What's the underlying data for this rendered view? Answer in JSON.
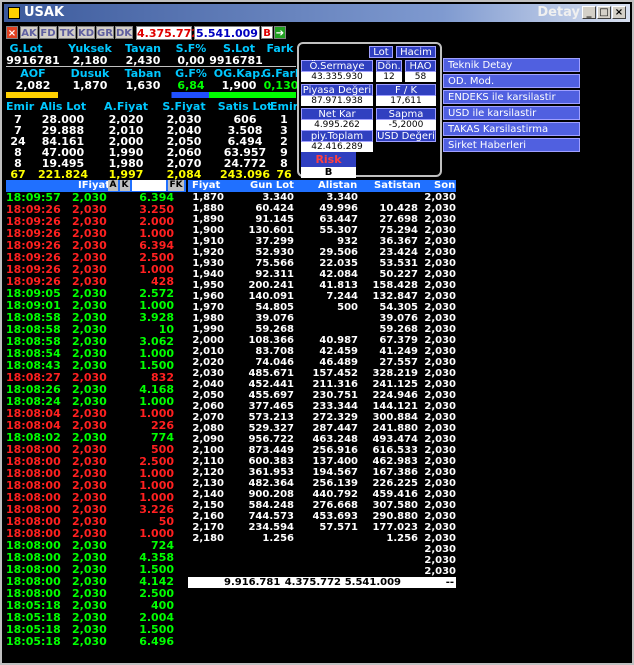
{
  "window": {
    "title": "USAK",
    "detail": "Detay",
    "min": "_",
    "max": "□",
    "close": "×"
  },
  "toolbar": {
    "buttons": [
      "AK",
      "FD",
      "TK",
      "KD",
      "GR",
      "DK"
    ],
    "value1": "4.375.772",
    "value2": "5.541.009",
    "b_label": "B"
  },
  "summary": {
    "row1_headers": [
      "G.Lot",
      "Yuksek",
      "Tavan",
      "S.F%",
      "S.Lot",
      "Fark"
    ],
    "row1_values": [
      "9916781",
      "2,180",
      "2,430",
      "0,00",
      "9916781",
      ""
    ],
    "row2_headers": [
      "AOF",
      "Dusuk",
      "Taban",
      "G.F%",
      "OG.Kap.",
      "G.Fark"
    ],
    "row2_values": [
      "2,082",
      "1,870",
      "1,630",
      "6,84",
      "1,900",
      "0,130"
    ]
  },
  "depth": {
    "headers": [
      "Emir",
      "Alis Lot",
      "A.Fiyat",
      "S.Fiyat",
      "Satis Lot",
      "Emir"
    ],
    "rows": [
      [
        "7",
        "28.000",
        "2,020",
        "2,030",
        "606",
        "1"
      ],
      [
        "7",
        "29.888",
        "2,010",
        "2,040",
        "3.508",
        "3"
      ],
      [
        "24",
        "84.161",
        "2,000",
        "2,050",
        "6.494",
        "2"
      ],
      [
        "8",
        "47.000",
        "1,990",
        "2,060",
        "63.957",
        "9"
      ],
      [
        "8",
        "19.495",
        "1,980",
        "2,070",
        "24.772",
        "8"
      ]
    ],
    "total": [
      "67",
      "221.824",
      "1,997",
      "2,084",
      "243.096",
      "76"
    ]
  },
  "panel": {
    "tabs": [
      "Lot",
      "Hacim"
    ],
    "fields": [
      {
        "label": "Ö.Sermaye",
        "value": "43.335.930"
      },
      {
        "label": "Dön.",
        "value": "12"
      },
      {
        "label": "HAO",
        "value": "58"
      },
      {
        "label": "Piyasa Değeri",
        "value": "87.971.938"
      },
      {
        "label": "F / K",
        "value": "17,611"
      },
      {
        "label": "Net Kar",
        "value": "4.995.262"
      },
      {
        "label": "Sapma",
        "value": "-5,2000"
      },
      {
        "label": "piy.Toplam Lot",
        "value": "42.416.289"
      },
      {
        "label": "USD Değeri",
        "value": ""
      }
    ],
    "risk_label": "Risk Kodu",
    "risk_value": "B"
  },
  "menu": [
    "Teknik Detay",
    "OD. Mod.",
    "ENDEKS ile karsilastir",
    "USD ile karsilastir",
    "TAKAS Karsilastirma",
    "Sirket Haberleri"
  ],
  "trades_header": {
    "price": "IFiyat",
    "a": "A",
    "k": "K",
    "fk": "FK"
  },
  "trades": [
    {
      "t": "18:09:57",
      "p": "2,030",
      "q": "6.394",
      "c": "green"
    },
    {
      "t": "18:09:26",
      "p": "2,030",
      "q": "3.250",
      "c": "red"
    },
    {
      "t": "18:09:26",
      "p": "2,030",
      "q": "2.000",
      "c": "red"
    },
    {
      "t": "18:09:26",
      "p": "2,030",
      "q": "1.000",
      "c": "red"
    },
    {
      "t": "18:09:26",
      "p": "2,030",
      "q": "6.394",
      "c": "red"
    },
    {
      "t": "18:09:26",
      "p": "2,030",
      "q": "2.500",
      "c": "red"
    },
    {
      "t": "18:09:26",
      "p": "2,030",
      "q": "1.000",
      "c": "red"
    },
    {
      "t": "18:09:26",
      "p": "2,030",
      "q": "428",
      "c": "red"
    },
    {
      "t": "18:09:05",
      "p": "2,030",
      "q": "2.572",
      "c": "green"
    },
    {
      "t": "18:09:01",
      "p": "2,030",
      "q": "1.000",
      "c": "green"
    },
    {
      "t": "18:08:58",
      "p": "2,030",
      "q": "3.928",
      "c": "green"
    },
    {
      "t": "18:08:58",
      "p": "2,030",
      "q": "10",
      "c": "green"
    },
    {
      "t": "18:08:58",
      "p": "2,030",
      "q": "3.062",
      "c": "green"
    },
    {
      "t": "18:08:54",
      "p": "2,030",
      "q": "1.000",
      "c": "green"
    },
    {
      "t": "18:08:43",
      "p": "2,030",
      "q": "1.500",
      "c": "green"
    },
    {
      "t": "18:08:27",
      "p": "2,030",
      "q": "832",
      "c": "red"
    },
    {
      "t": "18:08:26",
      "p": "2,030",
      "q": "4.168",
      "c": "green"
    },
    {
      "t": "18:08:24",
      "p": "2,030",
      "q": "1.000",
      "c": "green"
    },
    {
      "t": "18:08:04",
      "p": "2,030",
      "q": "1.000",
      "c": "red"
    },
    {
      "t": "18:08:04",
      "p": "2,030",
      "q": "226",
      "c": "red"
    },
    {
      "t": "18:08:02",
      "p": "2,030",
      "q": "774",
      "c": "green"
    },
    {
      "t": "18:08:00",
      "p": "2,030",
      "q": "500",
      "c": "red"
    },
    {
      "t": "18:08:00",
      "p": "2,030",
      "q": "2.500",
      "c": "red"
    },
    {
      "t": "18:08:00",
      "p": "2,030",
      "q": "1.000",
      "c": "red"
    },
    {
      "t": "18:08:00",
      "p": "2,030",
      "q": "1.000",
      "c": "red"
    },
    {
      "t": "18:08:00",
      "p": "2,030",
      "q": "1.000",
      "c": "red"
    },
    {
      "t": "18:08:00",
      "p": "2,030",
      "q": "3.226",
      "c": "red"
    },
    {
      "t": "18:08:00",
      "p": "2,030",
      "q": "50",
      "c": "red"
    },
    {
      "t": "18:08:00",
      "p": "2,030",
      "q": "1.000",
      "c": "red"
    },
    {
      "t": "18:08:00",
      "p": "2,030",
      "q": "724",
      "c": "green"
    },
    {
      "t": "18:08:00",
      "p": "2,030",
      "q": "4.358",
      "c": "green"
    },
    {
      "t": "18:08:00",
      "p": "2,030",
      "q": "1.500",
      "c": "green"
    },
    {
      "t": "18:08:00",
      "p": "2,030",
      "q": "4.142",
      "c": "green"
    },
    {
      "t": "18:08:00",
      "p": "2,030",
      "q": "2.500",
      "c": "green"
    },
    {
      "t": "18:05:18",
      "p": "2,030",
      "q": "400",
      "c": "green"
    },
    {
      "t": "18:05:18",
      "p": "2,030",
      "q": "2.004",
      "c": "green"
    },
    {
      "t": "18:05:18",
      "p": "2,030",
      "q": "1.500",
      "c": "green"
    },
    {
      "t": "18:05:18",
      "p": "2,030",
      "q": "6.496",
      "c": "green"
    }
  ],
  "price_header": [
    "Fiyat",
    "Gun Lot",
    "Alistan",
    "Satistan",
    "Son"
  ],
  "price_rows": [
    [
      "1,870",
      "3.340",
      "3.340",
      "",
      "2,030"
    ],
    [
      "1,880",
      "60.424",
      "49.996",
      "10.428",
      "2,030"
    ],
    [
      "1,890",
      "91.145",
      "63.447",
      "27.698",
      "2,030"
    ],
    [
      "1,900",
      "130.601",
      "55.307",
      "75.294",
      "2,030"
    ],
    [
      "1,910",
      "37.299",
      "932",
      "36.367",
      "2,030"
    ],
    [
      "1,920",
      "52.930",
      "29.506",
      "23.424",
      "2,030"
    ],
    [
      "1,930",
      "75.566",
      "22.035",
      "53.531",
      "2,030"
    ],
    [
      "1,940",
      "92.311",
      "42.084",
      "50.227",
      "2,030"
    ],
    [
      "1,950",
      "200.241",
      "41.813",
      "158.428",
      "2,030"
    ],
    [
      "1,960",
      "140.091",
      "7.244",
      "132.847",
      "2,030"
    ],
    [
      "1,970",
      "54.805",
      "500",
      "54.305",
      "2,030"
    ],
    [
      "1,980",
      "39.076",
      "",
      "39.076",
      "2,030"
    ],
    [
      "1,990",
      "59.268",
      "",
      "59.268",
      "2,030"
    ],
    [
      "2,000",
      "108.366",
      "40.987",
      "67.379",
      "2,030"
    ],
    [
      "2,010",
      "83.708",
      "42.459",
      "41.249",
      "2,030"
    ],
    [
      "2,020",
      "74.046",
      "46.489",
      "27.557",
      "2,030"
    ],
    [
      "2,030",
      "485.671",
      "157.452",
      "328.219",
      "2,030"
    ],
    [
      "2,040",
      "452.441",
      "211.316",
      "241.125",
      "2,030"
    ],
    [
      "2,050",
      "455.697",
      "230.751",
      "224.946",
      "2,030"
    ],
    [
      "2,060",
      "377.465",
      "233.344",
      "144.121",
      "2,030"
    ],
    [
      "2,070",
      "573.213",
      "272.329",
      "300.884",
      "2,030"
    ],
    [
      "2,080",
      "529.327",
      "287.447",
      "241.880",
      "2,030"
    ],
    [
      "2,090",
      "956.722",
      "463.248",
      "493.474",
      "2,030"
    ],
    [
      "2,100",
      "873.449",
      "256.916",
      "616.533",
      "2,030"
    ],
    [
      "2,110",
      "600.383",
      "137.400",
      "462.983",
      "2,030"
    ],
    [
      "2,120",
      "361.953",
      "194.567",
      "167.386",
      "2,030"
    ],
    [
      "2,130",
      "482.364",
      "256.139",
      "226.225",
      "2,030"
    ],
    [
      "2,140",
      "900.208",
      "440.792",
      "459.416",
      "2,030"
    ],
    [
      "2,150",
      "584.248",
      "276.668",
      "307.580",
      "2,030"
    ],
    [
      "2,160",
      "744.573",
      "453.693",
      "290.880",
      "2,030"
    ],
    [
      "2,170",
      "234.594",
      "57.571",
      "177.023",
      "2,030"
    ],
    [
      "2,180",
      "1.256",
      "",
      "1.256",
      "2,030"
    ],
    [
      "",
      "",
      "",
      "",
      "2,030"
    ],
    [
      "",
      "",
      "",
      "",
      "2,030"
    ],
    [
      "",
      "",
      "",
      "",
      "2,030"
    ]
  ],
  "price_totals": [
    "9.916.781",
    "4.375.772",
    "5.541.009",
    "--"
  ],
  "colors": {
    "green": "#00ff00",
    "red": "#ff2020",
    "cyan": "#00c8ff",
    "yellow": "#ffff00",
    "header_blue": "#2070ff"
  }
}
